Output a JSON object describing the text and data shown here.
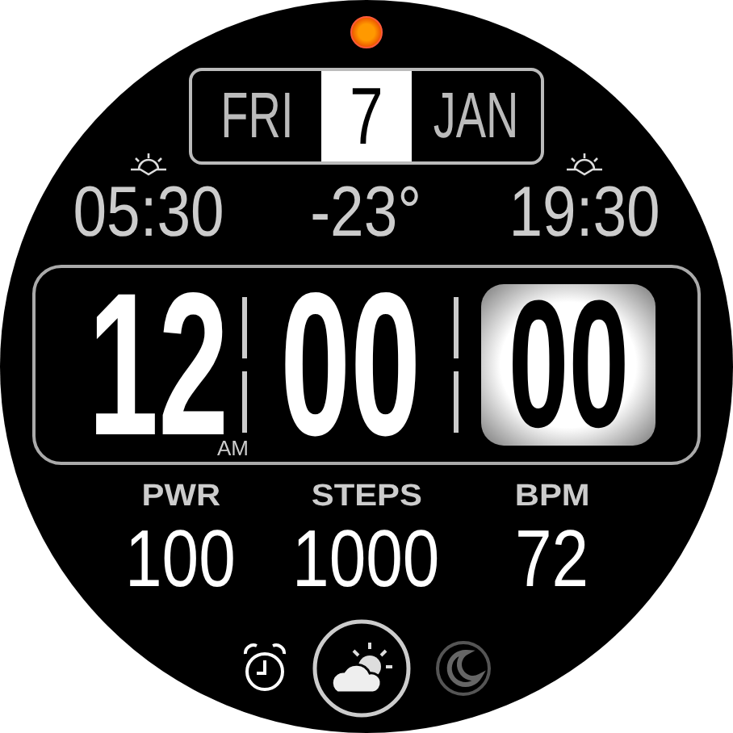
{
  "date": {
    "weekday": "FRI",
    "day": "7",
    "month": "JAN"
  },
  "sun": {
    "sunrise": "05:30",
    "temperature": "-23°",
    "sunset": "19:30"
  },
  "time": {
    "hours": "12",
    "minutes": "00",
    "seconds": "00",
    "period": "AM"
  },
  "stats": [
    {
      "label": "PWR",
      "value": "100"
    },
    {
      "label": "STEPS",
      "value": "1000"
    },
    {
      "label": "BPM",
      "value": "72"
    }
  ]
}
